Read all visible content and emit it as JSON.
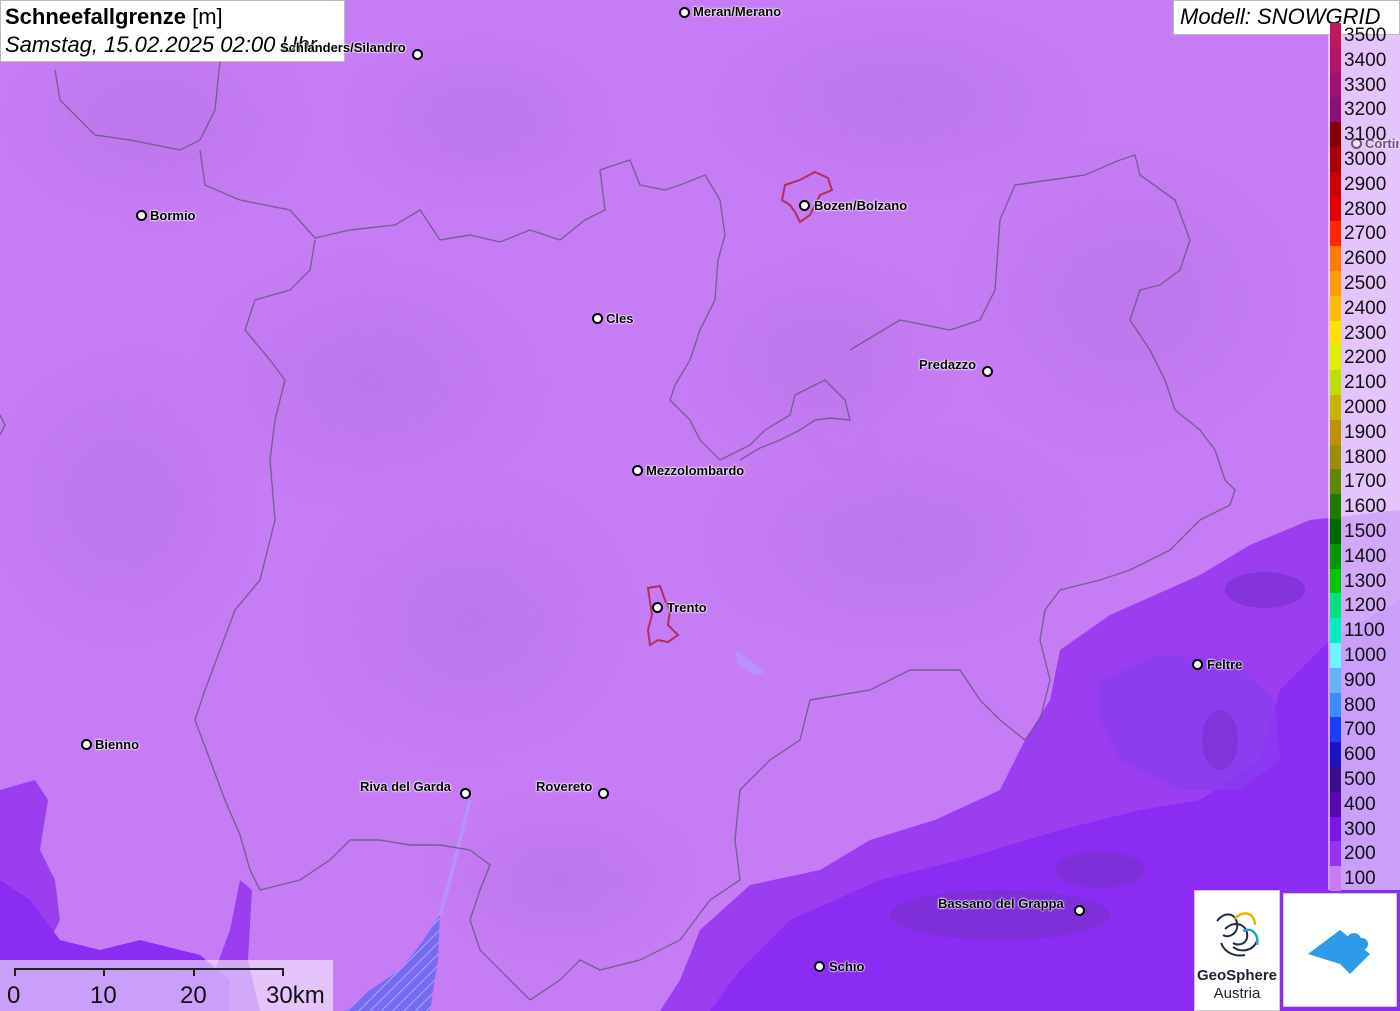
{
  "title": {
    "main": "Schneefallgrenze",
    "unit": "[m]",
    "date": "Samstag, 15.02.2025 02:00 Uhr"
  },
  "model": {
    "label": "Modell: SNOWGRID"
  },
  "legend": {
    "items": [
      {
        "label": "3500",
        "color": "#c2155f"
      },
      {
        "label": "3400",
        "color": "#b5146a"
      },
      {
        "label": "3300",
        "color": "#a21076"
      },
      {
        "label": "3200",
        "color": "#8c0f78"
      },
      {
        "label": "3100",
        "color": "#860000"
      },
      {
        "label": "3000",
        "color": "#ad0000"
      },
      {
        "label": "2900",
        "color": "#cc0000"
      },
      {
        "label": "2800",
        "color": "#e80000"
      },
      {
        "label": "2700",
        "color": "#ff2a00"
      },
      {
        "label": "2600",
        "color": "#ff7a00"
      },
      {
        "label": "2500",
        "color": "#ff9d00"
      },
      {
        "label": "2400",
        "color": "#ffbb00"
      },
      {
        "label": "2300",
        "color": "#ffe000"
      },
      {
        "label": "2200",
        "color": "#e0ee00"
      },
      {
        "label": "2100",
        "color": "#bde000"
      },
      {
        "label": "2000",
        "color": "#c8b400"
      },
      {
        "label": "1900",
        "color": "#bc9300"
      },
      {
        "label": "1800",
        "color": "#9a8f00"
      },
      {
        "label": "1700",
        "color": "#5f8a00"
      },
      {
        "label": "1600",
        "color": "#1f7a00"
      },
      {
        "label": "1500",
        "color": "#006a00"
      },
      {
        "label": "1400",
        "color": "#009a00"
      },
      {
        "label": "1300",
        "color": "#00c800"
      },
      {
        "label": "1200",
        "color": "#00e07a"
      },
      {
        "label": "1100",
        "color": "#00efc0"
      },
      {
        "label": "1000",
        "color": "#70f3ff"
      },
      {
        "label": "900",
        "color": "#6ab0f5"
      },
      {
        "label": "800",
        "color": "#3a8cf7"
      },
      {
        "label": "700",
        "color": "#1d3cf5"
      },
      {
        "label": "600",
        "color": "#1a14c2"
      },
      {
        "label": "500",
        "color": "#3a0d8c"
      },
      {
        "label": "400",
        "color": "#5a07b0"
      },
      {
        "label": "300",
        "color": "#7a16e8"
      },
      {
        "label": "200",
        "color": "#9a30f0"
      },
      {
        "label": "100",
        "color": "#c67cf5"
      }
    ]
  },
  "cities": [
    {
      "name": "Meran/Merano"
    },
    {
      "name": "Schlanders/Silandro"
    },
    {
      "name": "Bormio"
    },
    {
      "name": "Bozen/Bolzano"
    },
    {
      "name": "Cles"
    },
    {
      "name": "Predazzo"
    },
    {
      "name": "Mezzolombardo"
    },
    {
      "name": "Trento"
    },
    {
      "name": "Feltre"
    },
    {
      "name": "Bienno"
    },
    {
      "name": "Riva del Garda"
    },
    {
      "name": "Rovereto"
    },
    {
      "name": "Bassano del Grappa"
    },
    {
      "name": "Schio"
    },
    {
      "name": "Cortina"
    }
  ],
  "scalebar": {
    "labels": [
      "0",
      "10",
      "20",
      "30km"
    ]
  },
  "logos": {
    "geosphere": {
      "line1": "GeoSphere",
      "line2": "Austria"
    }
  }
}
